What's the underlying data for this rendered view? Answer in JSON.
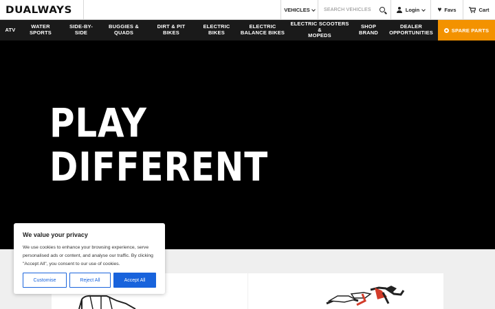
{
  "brand": {
    "logo_text": "DUALWAYS"
  },
  "topbar": {
    "vehicles_label": "VEHICLES",
    "search_placeholder": "SEARCH VEHICLES",
    "login_label": "Login",
    "favs_label": "Favs",
    "cart_label": "Cart"
  },
  "nav": {
    "items": [
      {
        "label": "ATV"
      },
      {
        "label": "WATER\nSPORTS"
      },
      {
        "label": "SIDE-BY-\nSIDE"
      },
      {
        "label": "BUGGIES &\nQUADS"
      },
      {
        "label": "DIRT & PIT\nBIKES"
      },
      {
        "label": "ELECTRIC\nBIKES"
      },
      {
        "label": "ELECTRIC\nBALANCE BIKES"
      },
      {
        "label": "ELECTRIC SCOOTERS &\nMOPEDS"
      },
      {
        "label": "SHOP\nBRAND"
      },
      {
        "label": "DEALER\nOPPORTUNITIES"
      }
    ],
    "spare_parts_label": "SPARE PARTS",
    "accent_color": "#f39200"
  },
  "hero": {
    "line1": "PLAY",
    "line2": "DIFFERENT"
  },
  "cookie": {
    "title": "We value your privacy",
    "body": "We use cookies to enhance your browsing experience, serve personalised ads or content, and analyse our traffic. By clicking \"Accept All\", you consent to our use of cookies.",
    "customise_label": "Customise",
    "reject_label": "Reject All",
    "accept_label": "Accept All",
    "button_color": "#1863dc"
  }
}
